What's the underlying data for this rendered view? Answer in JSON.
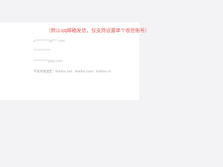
{
  "notice": {
    "text": "（默认qq邮箱发信，仅支持设置单个收信账号）",
    "color": "#e8534b"
  },
  "email_list": {
    "items": [
      {
        "text": "a*********@***.com",
        "blurred": true
      },
      {
        "text": "***********",
        "blurred": true
      },
      {
        "text": "*********@qq.com",
        "blurred": true
      },
      {
        "text": "不支持发送至：linkfox.net、linkfox.com、linkfox.cn",
        "blurred": false
      }
    ]
  },
  "colors": {
    "background": "#f3f3f5",
    "card": "#ffffff",
    "text_muted": "#9a9aa0"
  }
}
